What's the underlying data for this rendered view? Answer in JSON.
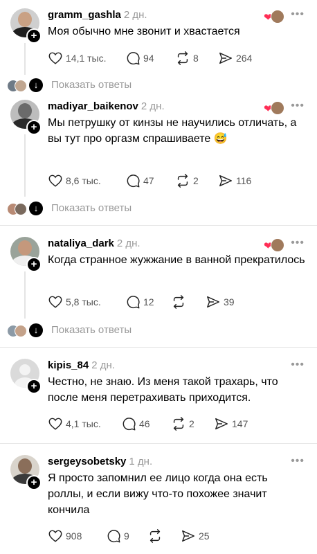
{
  "comments": [
    {
      "username": "gramm_gashla",
      "time": "2 дн.",
      "text": "Моя обычно мне звонит и хвастается",
      "likes": "14,1 тыс.",
      "comments": "94",
      "reposts": "8",
      "shares": "264",
      "liked_by_author": true,
      "show_replies": "Показать ответы"
    },
    {
      "username": "madiyar_baikenov",
      "time": "2 дн.",
      "text": "Мы петрушку от кинзы не научились отличать, а вы тут про оргазм спрашиваете 😅",
      "likes": "8,6 тыс.",
      "comments": "47",
      "reposts": "2",
      "shares": "116",
      "liked_by_author": true,
      "show_replies": "Показать ответы"
    },
    {
      "username": "nataliya_dark",
      "time": "2 дн.",
      "text": "Когда странное жужжание в ванной прекратилось",
      "likes": "5,8 тыс.",
      "comments": "12",
      "reposts": "",
      "shares": "39",
      "liked_by_author": true,
      "show_replies": "Показать ответы"
    },
    {
      "username": "kipis_84",
      "time": "2 дн.",
      "text": "Честно, не знаю. Из меня такой трахарь, что после меня перетрахивать приходится.",
      "likes": "4,1 тыс.",
      "comments": "46",
      "reposts": "2",
      "shares": "147",
      "liked_by_author": false
    },
    {
      "username": "sergeysobetsky",
      "time": "1 дн.",
      "text": "Я просто запомнил ее лицо когда она есть роллы, и если вижу что-то похожее значит кончила",
      "likes": "908",
      "comments": "9",
      "reposts": "",
      "shares": "25",
      "liked_by_author": false
    }
  ],
  "icons": {
    "more": "more-dots-icon",
    "like": "heart-icon",
    "comment": "comment-bubble-icon",
    "repost": "repost-icon",
    "share": "share-arrow-icon",
    "follow": "plus-icon",
    "expand": "arrow-down-icon"
  },
  "colors": {
    "liked_heart": "#ff2d55",
    "muted_text": "#999999",
    "text": "#000000"
  }
}
